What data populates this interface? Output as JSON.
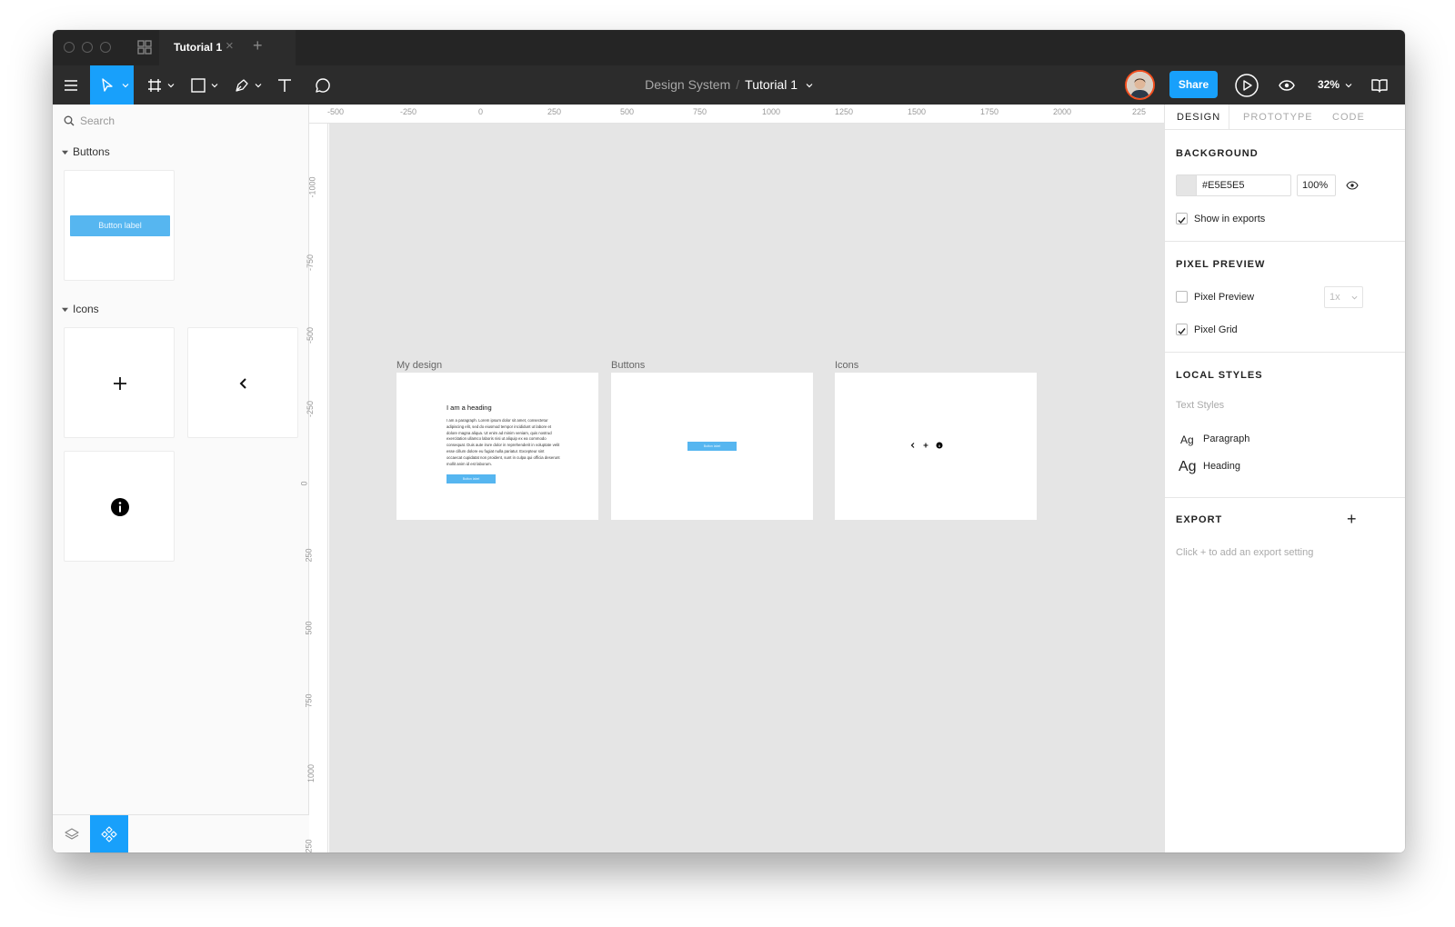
{
  "window": {
    "tab": {
      "title": "Tutorial 1",
      "close": "×",
      "add": "+"
    },
    "toolbar": {
      "breadcrumb": {
        "project": "Design System",
        "separator": "/",
        "file": "Tutorial 1"
      },
      "share_label": "Share",
      "zoom": "32%",
      "tools": [
        "menu-icon",
        "move-icon",
        "frame-icon",
        "rectangle-icon",
        "pen-icon",
        "text-icon",
        "comment-icon"
      ]
    }
  },
  "assets": {
    "search_placeholder": "Search",
    "sections": [
      {
        "title": "Buttons",
        "components": [
          {
            "type": "button",
            "label": "Button label"
          }
        ]
      },
      {
        "title": "Icons",
        "components": [
          "plus-icon",
          "chevron-left-icon",
          "info-icon"
        ]
      }
    ]
  },
  "rulers": {
    "top": [
      "-500",
      "-250",
      "0",
      "250",
      "500",
      "750",
      "1000",
      "1250",
      "1500",
      "1750",
      "2000",
      "225"
    ],
    "left": [
      "-1000",
      "-750",
      "-500",
      "-250",
      "0",
      "250",
      "500",
      "750",
      "1000",
      "250"
    ]
  },
  "canvas": {
    "background": "#E5E5E5",
    "frames": [
      {
        "label": "My design",
        "heading": "I am a heading",
        "paragraph": "I am a paragraph. Lorem ipsum dolor sit amet, consectetur adipiscing elit, sed do eiusmod tempor incididunt ut labore et dolore magna aliqua. Ut enim ad minim veniam, quis nostrud exercitation ullamco laboris nisi ut aliquip ex ea commodo consequat. Duis aute irure dolor in reprehenderit in voluptate velit esse cillum dolore eu fugiat nulla pariatur. Excepteur sint occaecat cupidatat non proident, sunt in culpa qui officia deserunt mollit anim id est laborum.",
        "button": "Button label"
      },
      {
        "label": "Buttons",
        "button": "Button label"
      },
      {
        "label": "Icons"
      }
    ]
  },
  "design_panel": {
    "tabs": [
      "DESIGN",
      "PROTOTYPE",
      "CODE"
    ],
    "background": {
      "title": "BACKGROUND",
      "hex": "#E5E5E5",
      "opacity": "100%",
      "show_in_exports": "Show in exports",
      "show_in_exports_checked": true
    },
    "pixel_preview": {
      "title": "PIXEL PREVIEW",
      "pixel_preview": "Pixel Preview",
      "pixel_preview_checked": false,
      "scale": "1x",
      "pixel_grid": "Pixel Grid",
      "pixel_grid_checked": true
    },
    "local_styles": {
      "title": "LOCAL STYLES",
      "subtitle": "Text Styles",
      "styles": [
        {
          "sample": "Ag",
          "name": "Paragraph"
        },
        {
          "sample": "Ag",
          "name": "Heading"
        }
      ]
    },
    "export": {
      "title": "EXPORT",
      "add": "+",
      "hint": "Click + to add an export setting"
    }
  },
  "colors": {
    "accent": "#18A0FB",
    "button": "#56B6F0",
    "avatar_ring": "#F24E1E"
  }
}
